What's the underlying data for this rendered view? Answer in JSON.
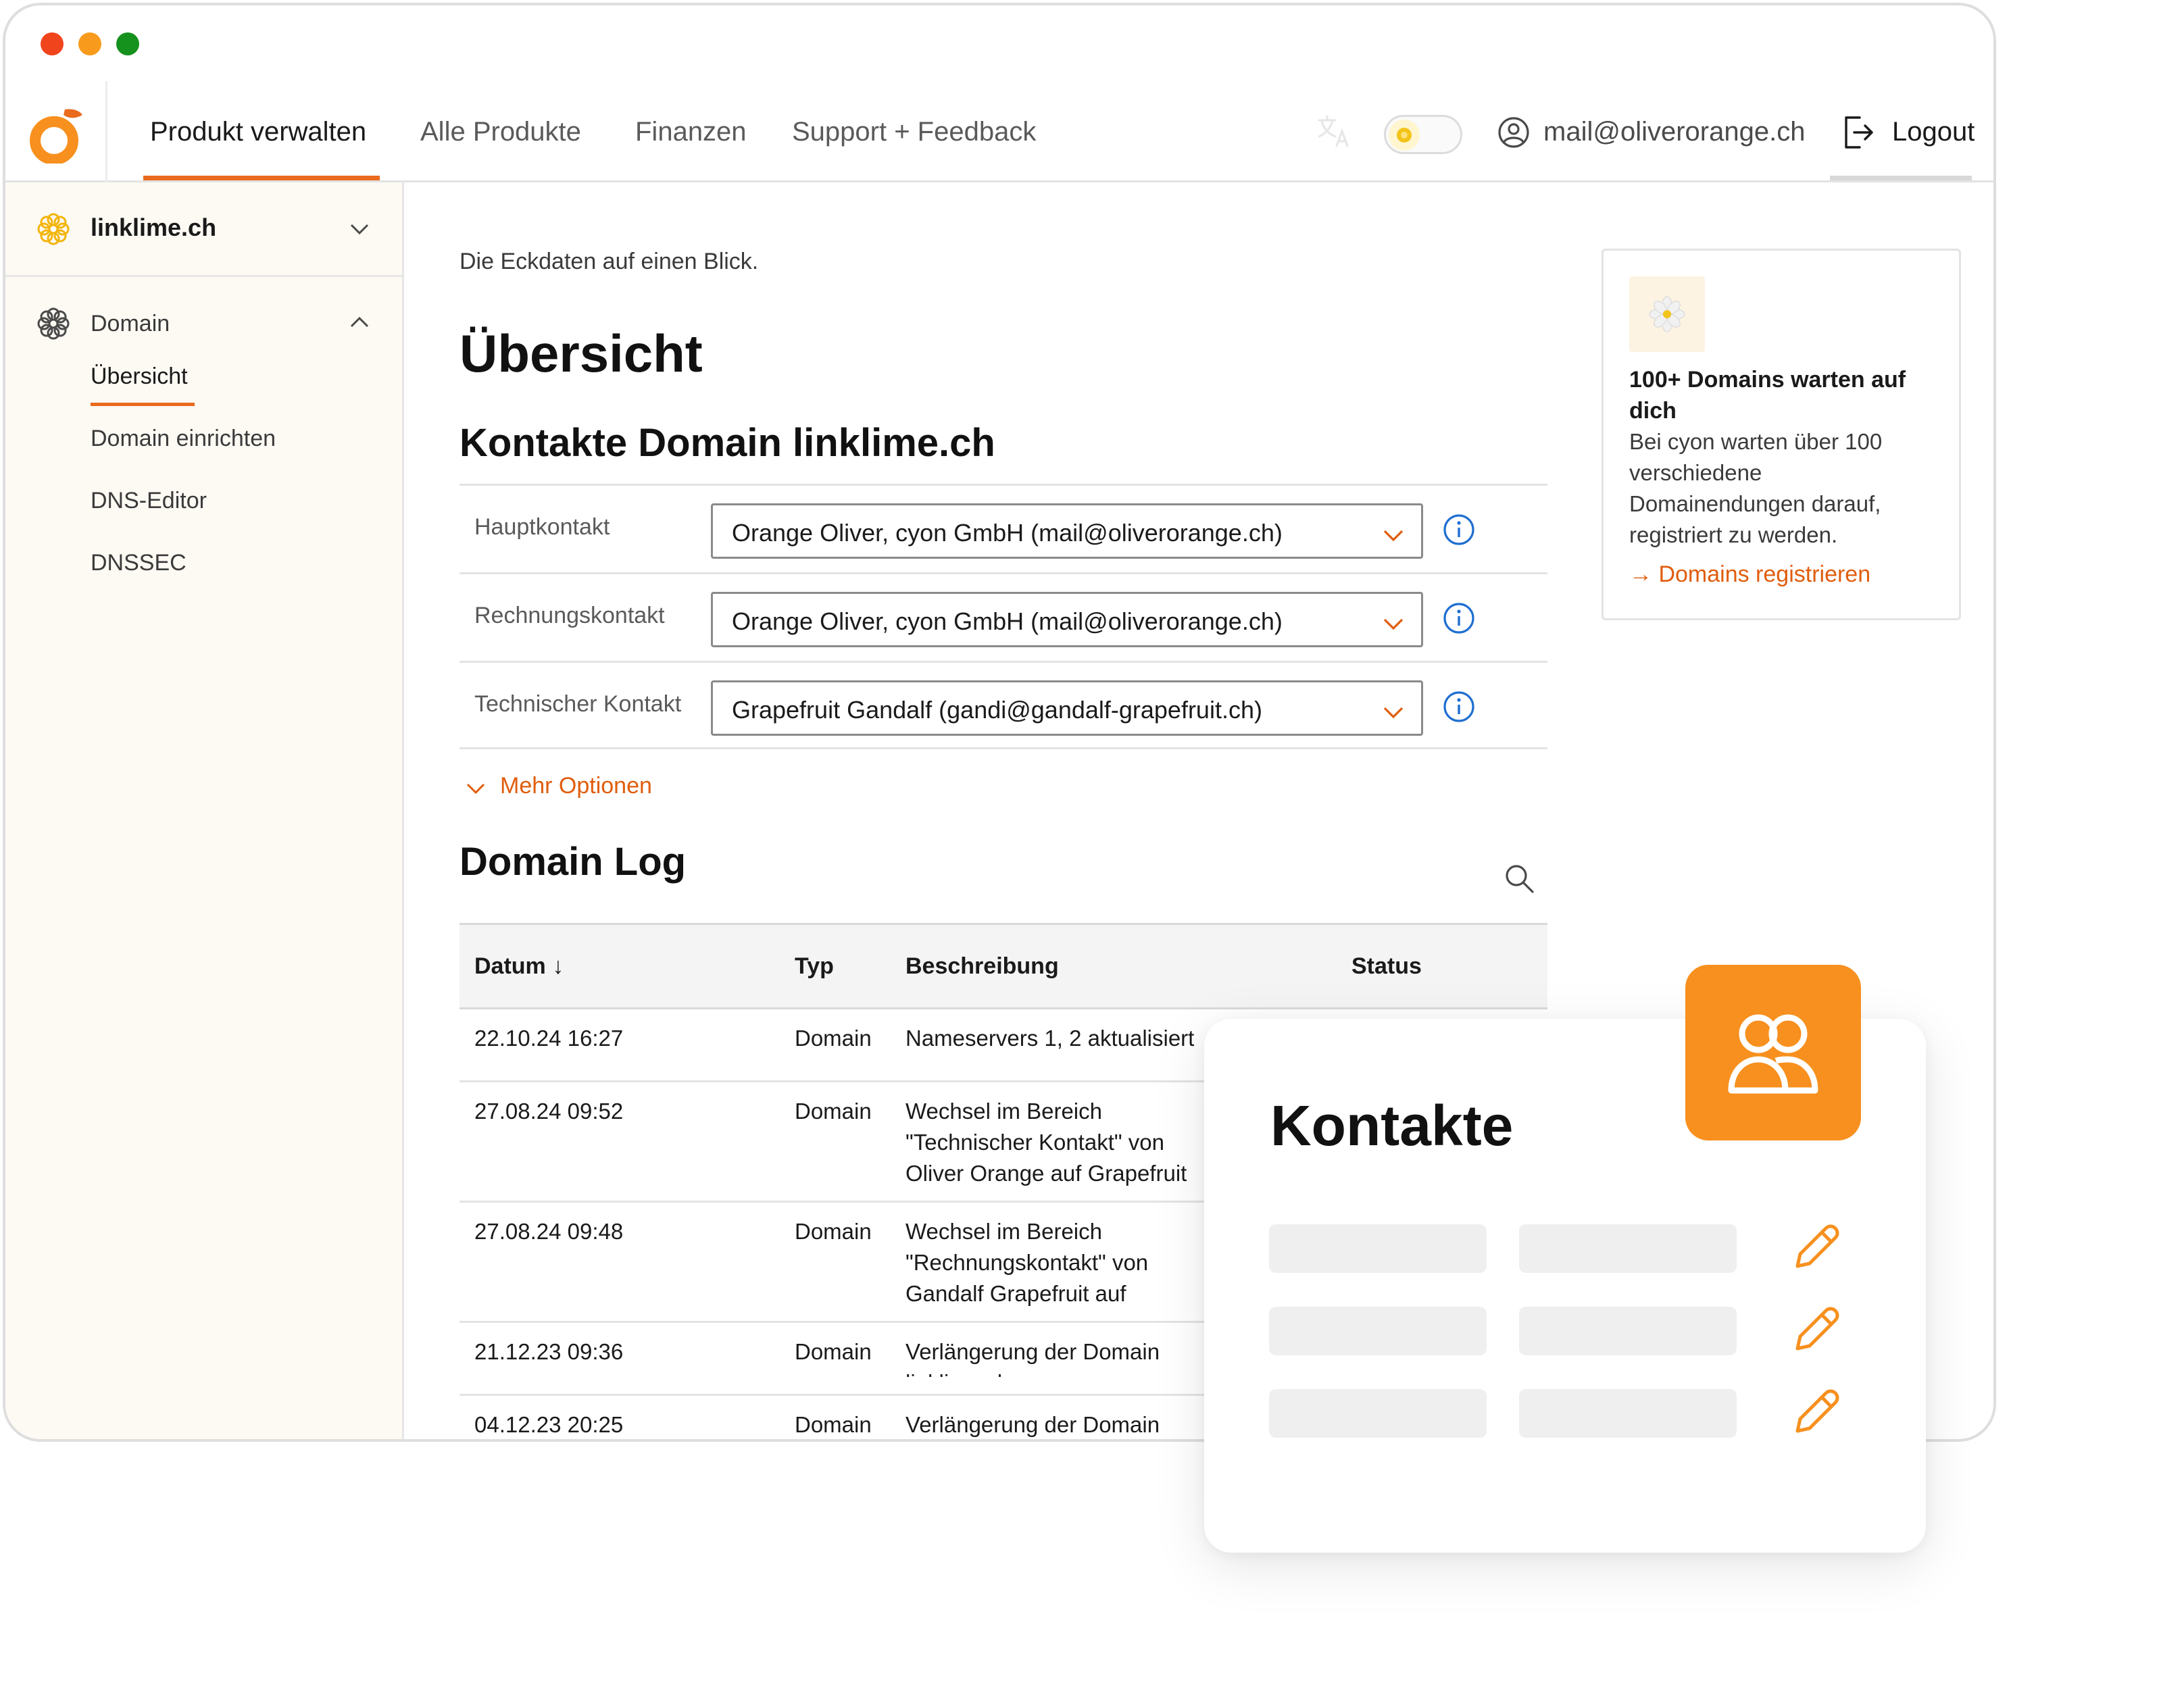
{
  "nav": {
    "items": [
      {
        "label": "Produkt verwalten",
        "active": true
      },
      {
        "label": "Alle Produkte",
        "active": false
      },
      {
        "label": "Finanzen",
        "active": false
      },
      {
        "label": "Support + Feedback",
        "active": false
      }
    ],
    "user_email": "mail@oliverorange.ch",
    "logout_label": "Logout"
  },
  "sidebar": {
    "site": "linklime.ch",
    "section": "Domain",
    "items": [
      {
        "label": "Übersicht",
        "active": true
      },
      {
        "label": "Domain einrichten",
        "active": false
      },
      {
        "label": "DNS-Editor",
        "active": false
      },
      {
        "label": "DNSSEC",
        "active": false
      }
    ]
  },
  "main": {
    "subtitle": "Die Eckdaten auf einen Blick.",
    "title": "Übersicht",
    "contacts_heading": "Kontakte Domain linklime.ch",
    "contacts": [
      {
        "label": "Hauptkontakt",
        "value": "Orange Oliver, cyon GmbH (mail@oliverorange.ch)"
      },
      {
        "label": "Rechnungskontakt",
        "value": "Orange Oliver, cyon GmbH (mail@oliverorange.ch)"
      },
      {
        "label": "Technischer Kontakt",
        "value": "Grapefruit Gandalf (gandi@gandalf-grapefruit.ch)"
      }
    ],
    "more_options": "Mehr Optionen",
    "log_heading": "Domain Log",
    "log_columns": {
      "date": "Datum ↓",
      "type": "Typ",
      "desc": "Beschreibung",
      "status": "Status"
    },
    "log_rows": [
      {
        "date": "22.10.24 16:27",
        "type": "Domain",
        "desc": "Nameservers 1, 2 aktualisiert"
      },
      {
        "date": "27.08.24 09:52",
        "type": "Domain",
        "desc": "Wechsel im Bereich \"Technischer Kontakt\" von Oliver Orange auf Grapefruit"
      },
      {
        "date": "27.08.24 09:48",
        "type": "Domain",
        "desc": "Wechsel im Bereich \"Rechnungskontakt\" von Gandalf Grapefruit auf Orange"
      },
      {
        "date": "21.12.23 09:36",
        "type": "Domain",
        "desc": "Verlängerung der Domain linklime.ch"
      },
      {
        "date": "04.12.23 20:25",
        "type": "Domain",
        "desc": "Verlängerung der Domain linklime.ch"
      }
    ]
  },
  "promo": {
    "title": "100+ Domains warten auf dich",
    "text": "Bei cyon warten über 100 verschiedene Domainendungen darauf, registriert zu werden.",
    "link": "→ Domains registrieren"
  },
  "overlay": {
    "title": "Kontakte"
  },
  "colors": {
    "accent": "#ea6a1e",
    "accent_text": "#e05d0d",
    "badge": "#f7901e",
    "info_blue": "#1f6fd1"
  },
  "icons": [
    "orange-logo-icon",
    "flower-icon",
    "gear-icon",
    "chevron-down-icon",
    "chevron-up-icon",
    "info-icon",
    "search-icon",
    "user-circle-icon",
    "logout-icon",
    "sun-icon",
    "translate-icon",
    "pencil-icon",
    "users-icon"
  ]
}
